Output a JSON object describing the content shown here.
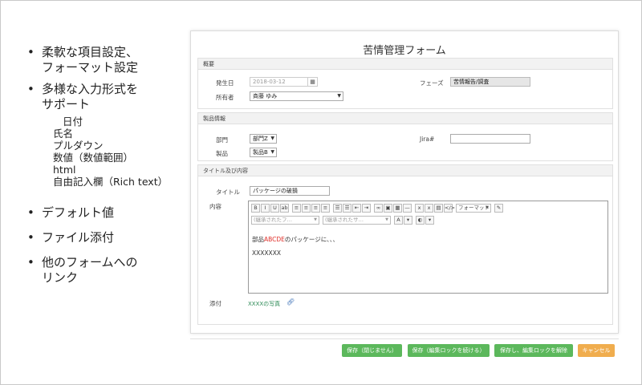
{
  "bullets": {
    "b1_line1": "柔軟な項目設定、",
    "b1_line2": "フォーマット設定",
    "b2_line1": "多様な入力形式を",
    "b2_line2": "サポート",
    "sub": [
      "日付",
      "氏名",
      "プルダウン",
      "数値（数値範囲）",
      "html",
      "自由記入欄（Rich text）"
    ],
    "b3": "デフォルト値",
    "b4": "ファイル添付",
    "b5_line1": "他のフォームへの",
    "b5_line2": "リンク"
  },
  "form": {
    "title": "苦情管理フォーム",
    "overview": {
      "header": "概要",
      "date_label": "発生日",
      "date_value": "2018-03-12",
      "calendar_icon": "calendar-icon",
      "owner_label": "所有者",
      "owner_value": "斉藤 ゆみ",
      "phase_label": "フェーズ",
      "phase_value": "苦情報告/調査"
    },
    "product": {
      "header": "製品情報",
      "dept_label": "部門",
      "dept_value": "部門Z",
      "product_label": "製品",
      "product_value": "製品B",
      "jira_label": "Jira#",
      "jira_value": ""
    },
    "content": {
      "header": "タイトル及び内容",
      "title_label": "タイトル",
      "title_value": "パッケージの破損",
      "body_label": "内容",
      "format_dd": "フォーマット",
      "font_dd1": "(継承されたフ…",
      "font_dd2": "(継承されたサ…",
      "text_prefix": "部品",
      "text_red": "ABCDE",
      "text_suffix": "のパッケージに、、、",
      "text_line2": "XXXXXXX",
      "attach_label": "添付",
      "attach_link": "XXXXの写真"
    }
  },
  "buttons": {
    "save_unlock": "保存（閉じません）",
    "save_keep_lock": "保存（編集ロックを続ける）",
    "save_release": "保存し、編集ロックを解除",
    "cancel": "キャンセル"
  },
  "colors": {
    "green": "#5cb85c",
    "orange": "#f0ad4e",
    "red_text": "#e0302a"
  }
}
